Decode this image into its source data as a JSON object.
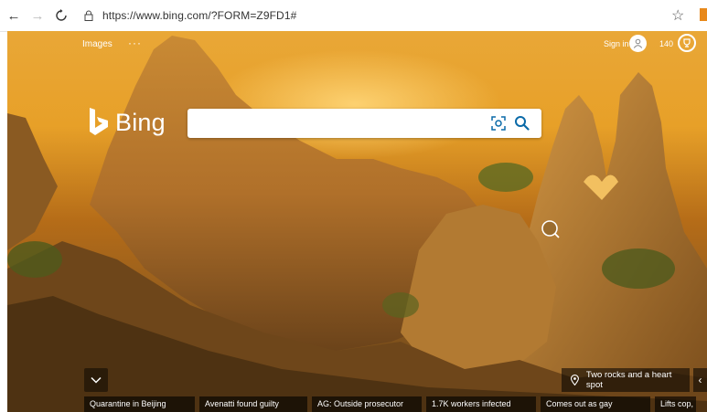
{
  "browser": {
    "url": "https://www.bing.com/?FORM=Z9FD1#"
  },
  "header": {
    "images_label": "Images",
    "more_label": "···",
    "sign_in_label": "Sign in",
    "rewards_points": "140"
  },
  "logo": {
    "text": "Bing"
  },
  "search": {
    "value": "",
    "placeholder": ""
  },
  "image_caption": {
    "text": "Two rocks and a heart spot"
  },
  "news": [
    {
      "label": "Quarantine in Beijing"
    },
    {
      "label": "Avenatti found guilty"
    },
    {
      "label": "AG: Outside prosecutor"
    },
    {
      "label": "1.7K workers infected"
    },
    {
      "label": "Comes out as gay"
    },
    {
      "label": "Lifts cop, is a"
    }
  ],
  "colors": {
    "bing_accent": "#ffffff",
    "search_icon": "#0a6aa8",
    "sky": "#e9a737"
  }
}
